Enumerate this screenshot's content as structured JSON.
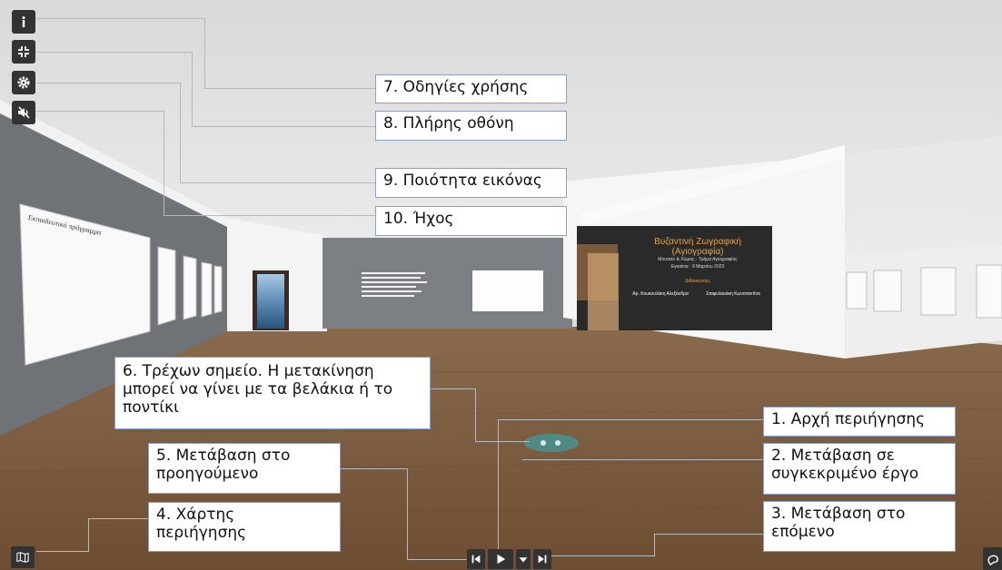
{
  "controls": {
    "info_icon": "info-icon",
    "fullscreen_icon": "fullscreen-exit-icon",
    "settings_icon": "gear-icon",
    "sound_icon": "sound-off-icon"
  },
  "callouts": {
    "c1": "1. Αρχή περιήγησης",
    "c2a": "2. Μετάβαση σε",
    "c2b": "συγκεκριμένο έργο",
    "c3a": "3. Μετάβαση στο",
    "c3b": "επόμενο",
    "c4a": "4. Χάρτης",
    "c4b": "περιήγησης",
    "c5a": "5. Μετάβαση στο",
    "c5b": "προηγούμενο",
    "c6a": "6. Τρέχων σημείο. Η μετακίνηση",
    "c6b": "μπορεί να γίνει με τα βελάκια ή το",
    "c6c": "ποντίκι",
    "c7": "7. Οδηγίες χρήσης",
    "c8": "8. Πλήρης οθόνη",
    "c9": "9. Ποιότητα εικόνας",
    "c10": "10. Ήχος"
  },
  "poster": {
    "title": "Βυζαντινή Ζωγραφική (Αγιογραφία)",
    "line1": "Μουσείο & Χώρος · Τμήμα Αγιογραφίας",
    "line2": "Εγκαίνια · 9 Μαρτίου 2023",
    "speakers_label": "Διδάσκοντες",
    "speaker1": "Αρ. Κουκουλάκη Αλεξάνδρα",
    "speaker2": "Σταφυλακάκη Κωνσταντίνα"
  },
  "left_panel": {
    "heading": "Εκπαιδευτικό πρόγραμμα"
  },
  "nav": {
    "prev_icon": "skip-back-icon",
    "play_icon": "play-icon",
    "dropdown_icon": "chevron-down-icon",
    "next_icon": "skip-forward-icon",
    "map_icon": "map-icon",
    "corner_icon": "chat-icon"
  },
  "colors": {
    "control_bg": "#333333",
    "callout_border": "#8aa0c8",
    "floor": "#7a5a3e",
    "wall_grey": "#6f7378",
    "poster_bg": "#2a2a2a",
    "poster_title": "#e2a24a"
  }
}
